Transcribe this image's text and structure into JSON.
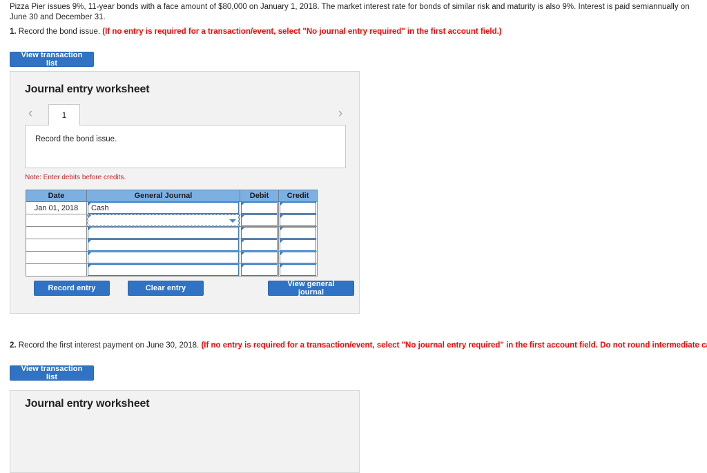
{
  "problem": {
    "text": "Pizza Pier issues 9%, 11-year bonds with a face amount of $80,000 on January 1, 2018. The market interest rate for bonds of similar risk and maturity is also 9%. Interest is paid semiannually on June 30 and December 31."
  },
  "requirements": [
    {
      "number": "1.",
      "text": " Record the bond issue. ",
      "hint": "(If no entry is required for a transaction/event, select \"No journal entry required\" in the first account field.)"
    },
    {
      "number": "2.",
      "text": " Record the first interest payment on June 30, 2018. ",
      "hint": "(If no entry is required for a transaction/event, select \"No journal entry required\" in the first account field. Do not round intermediate calculations.)"
    }
  ],
  "view_transaction_list_label": "View transaction list",
  "worksheet1": {
    "title": "Journal entry worksheet",
    "prev_arrow": "‹",
    "next_arrow": "›",
    "tab_label": "1",
    "description": "Record the bond issue.",
    "note": "Note: Enter debits before credits.",
    "table": {
      "headers": [
        "Date",
        "General Journal",
        "Debit",
        "Credit"
      ],
      "rows": [
        {
          "date": "Jan 01, 2018",
          "account": "Cash",
          "debit": "",
          "credit": "",
          "state": "filled"
        },
        {
          "date": "",
          "account": "",
          "debit": "",
          "credit": "",
          "state": "selected"
        },
        {
          "date": "",
          "account": "",
          "debit": "",
          "credit": "",
          "state": "empty"
        },
        {
          "date": "",
          "account": "",
          "debit": "",
          "credit": "",
          "state": "empty"
        },
        {
          "date": "",
          "account": "",
          "debit": "",
          "credit": "",
          "state": "empty"
        },
        {
          "date": "",
          "account": "",
          "debit": "",
          "credit": "",
          "state": "empty"
        }
      ]
    },
    "actions": {
      "record_entry": "Record entry",
      "clear_entry": "Clear entry",
      "view_general_journal": "View general journal"
    }
  },
  "worksheet2": {
    "title": "Journal entry worksheet"
  },
  "colors": {
    "button_blue": "#3073c4",
    "table_header_blue": "#7cb0e3",
    "field_border_blue": "#3f7fbf",
    "hint_red": "#ff0000",
    "note_red": "#c0272d",
    "panel_bg": "#f2f2f2"
  }
}
